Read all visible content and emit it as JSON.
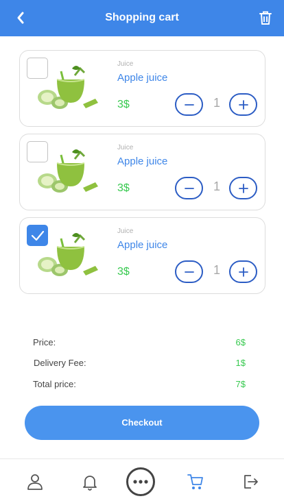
{
  "header": {
    "title": "Shopping cart",
    "back_icon": "chevron-left-icon",
    "delete_icon": "trash-icon",
    "color": "#3e86e8"
  },
  "cart": {
    "items": [
      {
        "category": "Juice",
        "name": "Apple juice",
        "price": "3$",
        "quantity": "1",
        "checked": false
      },
      {
        "category": "Juice",
        "name": "Apple juice",
        "price": "3$",
        "quantity": "1",
        "checked": false
      },
      {
        "category": "Juice",
        "name": "Apple juice",
        "price": "3$",
        "quantity": "1",
        "checked": true
      }
    ]
  },
  "summary": {
    "price_label": "Price:",
    "price_value": "6$",
    "delivery_label": "Delivery Fee:",
    "delivery_value": "1$",
    "total_label": "Total price:",
    "total_value": "7$"
  },
  "checkout": {
    "label": "Checkout"
  },
  "bottom_nav": {
    "items": [
      {
        "icon": "user-icon",
        "active": false
      },
      {
        "icon": "bell-icon",
        "active": false
      },
      {
        "icon": "more-icon",
        "active": false
      },
      {
        "icon": "cart-icon",
        "active": true
      },
      {
        "icon": "logout-icon",
        "active": false
      }
    ]
  },
  "colors": {
    "accent": "#3e86e8",
    "price": "#37c94f",
    "stepper_border": "#2b5cc4"
  }
}
